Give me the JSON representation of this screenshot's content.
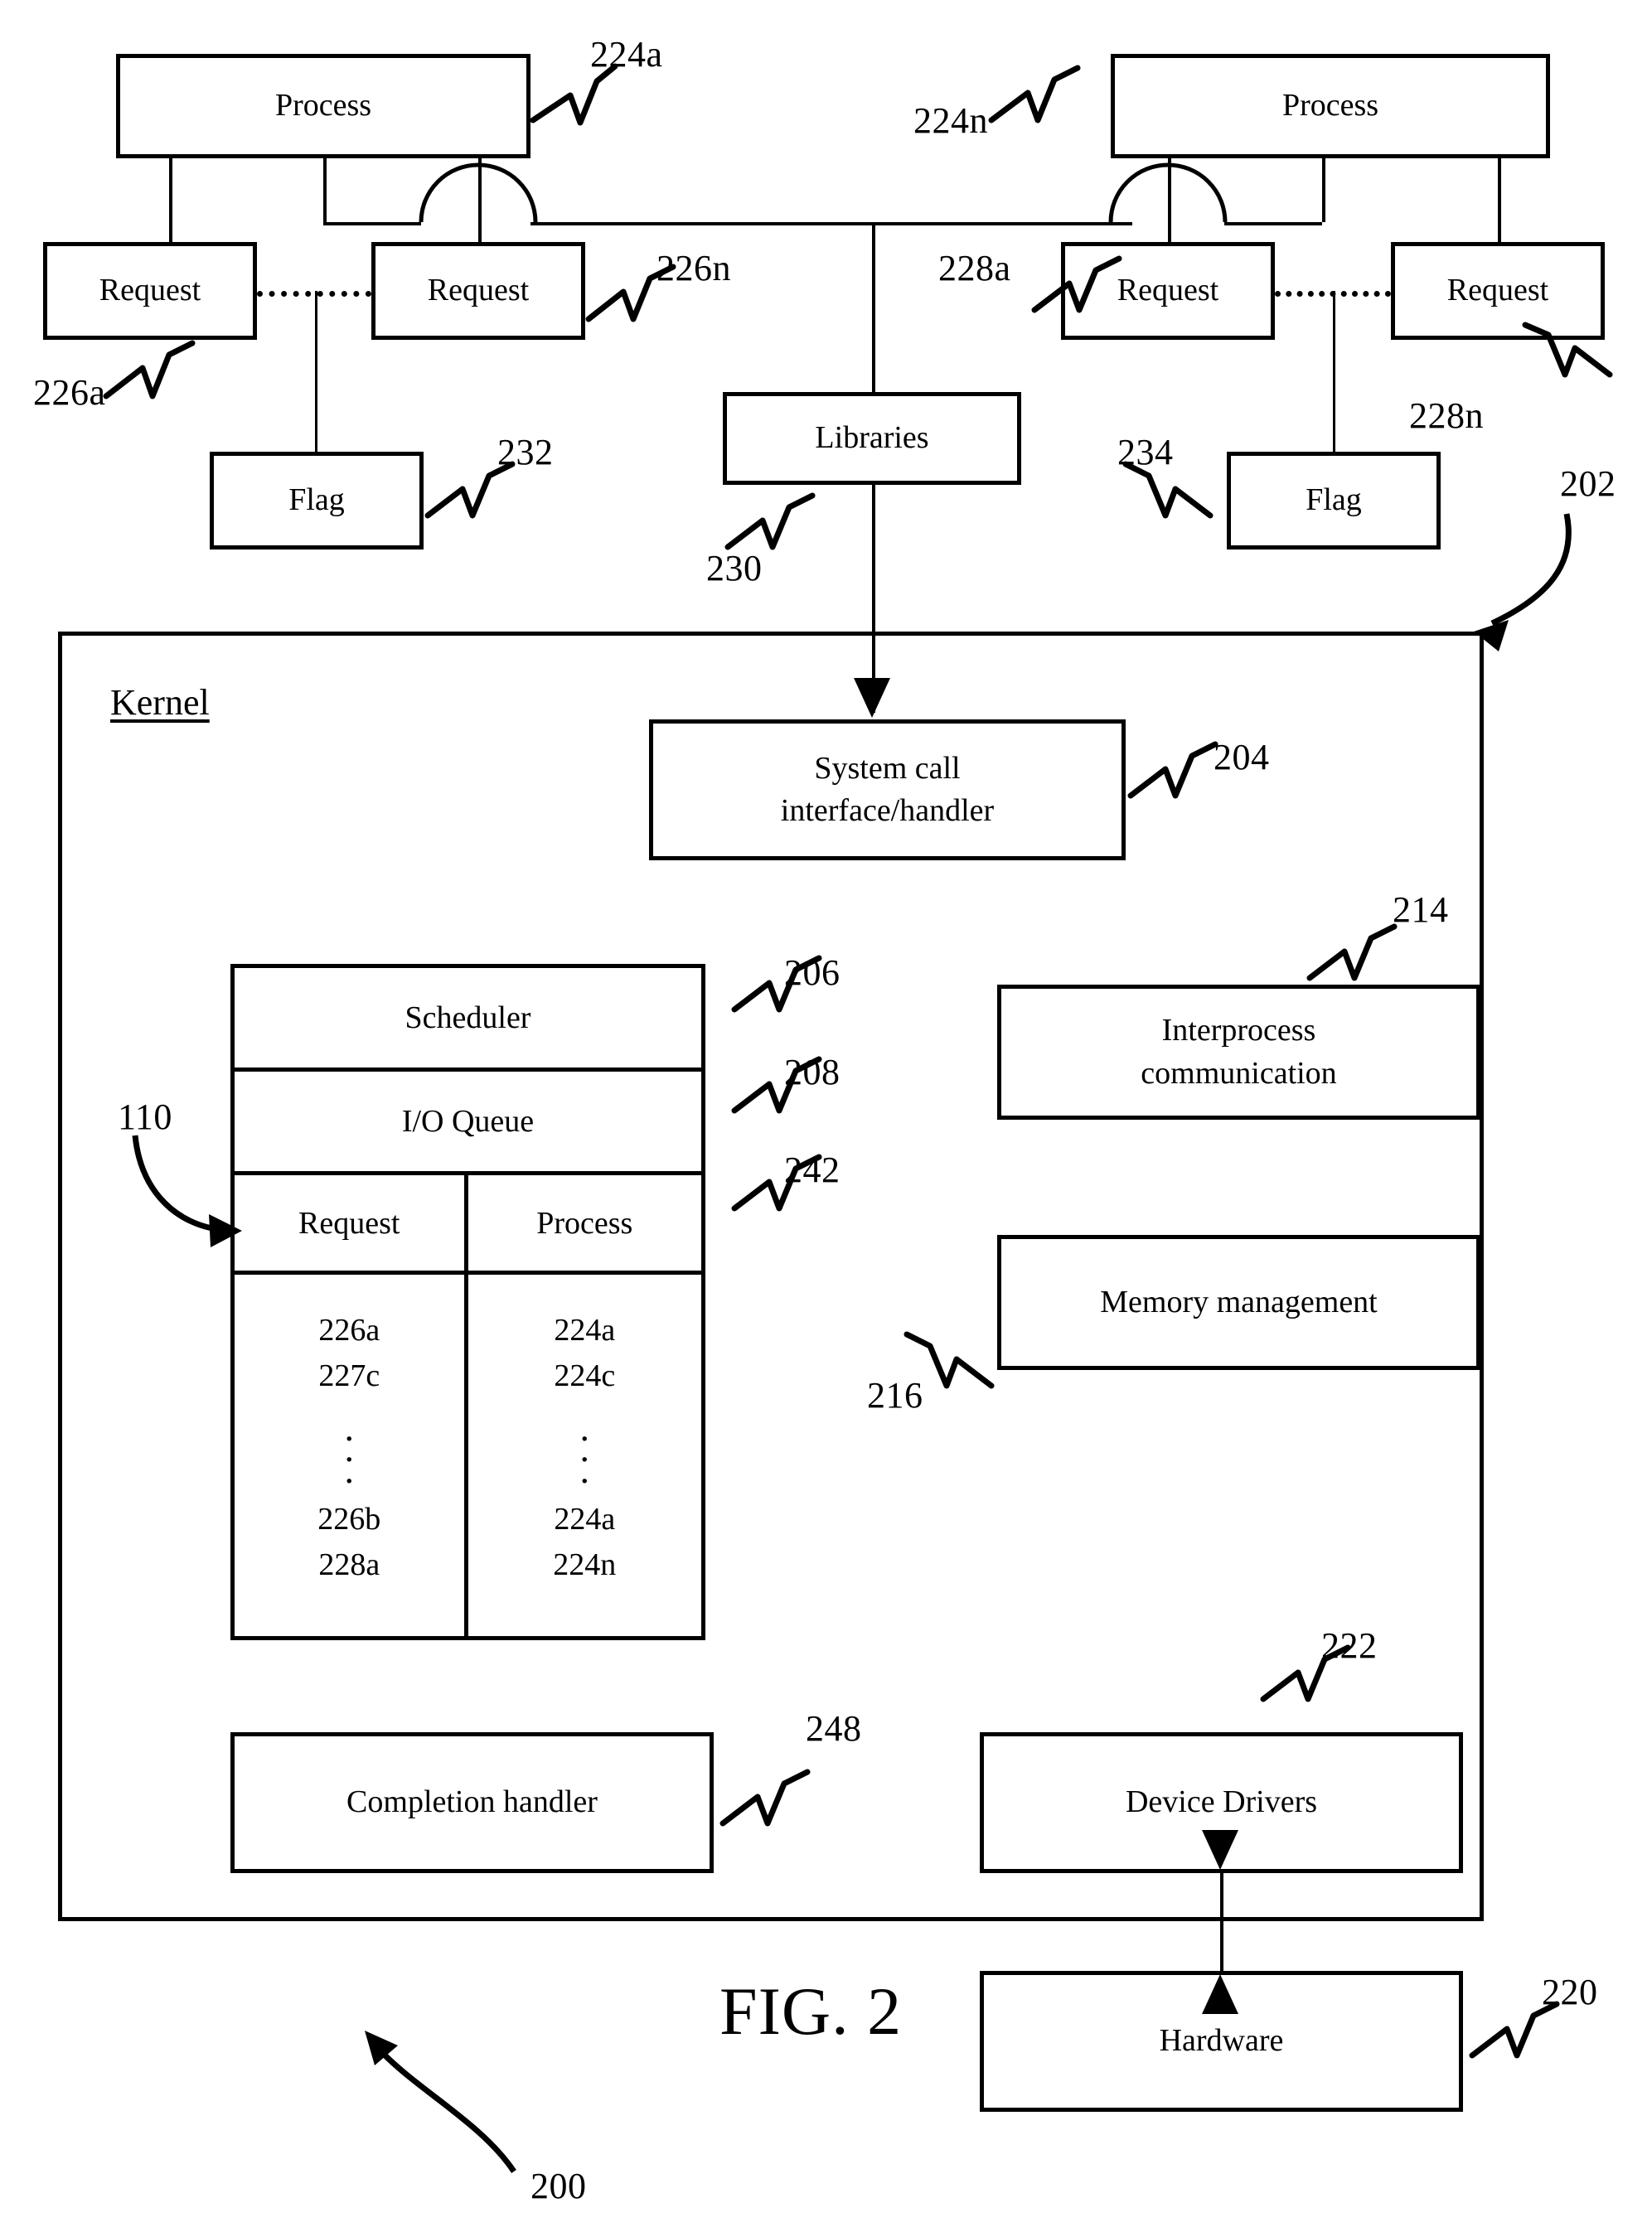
{
  "figure": {
    "caption": "FIG. 2",
    "system_ref": "200"
  },
  "userspace": {
    "process_a": {
      "label": "Process",
      "ref": "224a"
    },
    "process_n": {
      "label": "Process",
      "ref": "224n"
    },
    "request_226a": {
      "label": "Request",
      "ref": "226a"
    },
    "request_226n": {
      "label": "Request",
      "ref": "226n"
    },
    "request_228a": {
      "label": "Request",
      "ref": "228a"
    },
    "request_228n": {
      "label": "Request",
      "ref": "228n"
    },
    "flag_232": {
      "label": "Flag",
      "ref": "232"
    },
    "flag_234": {
      "label": "Flag",
      "ref": "234"
    },
    "libraries": {
      "label": "Libraries",
      "ref": "230"
    }
  },
  "kernel": {
    "title": "Kernel",
    "ref": "202",
    "system_call": {
      "label_line1": "System call",
      "label_line2": "interface/handler",
      "ref": "204"
    },
    "scheduler": {
      "label": "Scheduler",
      "ref": "206"
    },
    "io_queue": {
      "label": "I/O Queue",
      "ref": "208"
    },
    "queue_table": {
      "ref": "242",
      "pointer_ref": "110",
      "columns": [
        "Request",
        "Process"
      ],
      "rows_top": [
        [
          "226a",
          "224a"
        ],
        [
          "227c",
          "224c"
        ]
      ],
      "rows_bottom": [
        [
          "226b",
          "224a"
        ],
        [
          "228a",
          "224n"
        ]
      ],
      "ellipsis": "."
    },
    "interprocess": {
      "label_line1": "Interprocess",
      "label_line2": "communication",
      "ref": "214"
    },
    "memory_management": {
      "label": "Memory management",
      "ref": "216"
    },
    "completion_handler": {
      "label": "Completion handler",
      "ref": "248"
    },
    "device_drivers": {
      "label": "Device Drivers",
      "ref": "222"
    }
  },
  "hardware": {
    "label": "Hardware",
    "ref": "220"
  },
  "colors": {
    "ink": "#000000",
    "paper": "#ffffff"
  }
}
